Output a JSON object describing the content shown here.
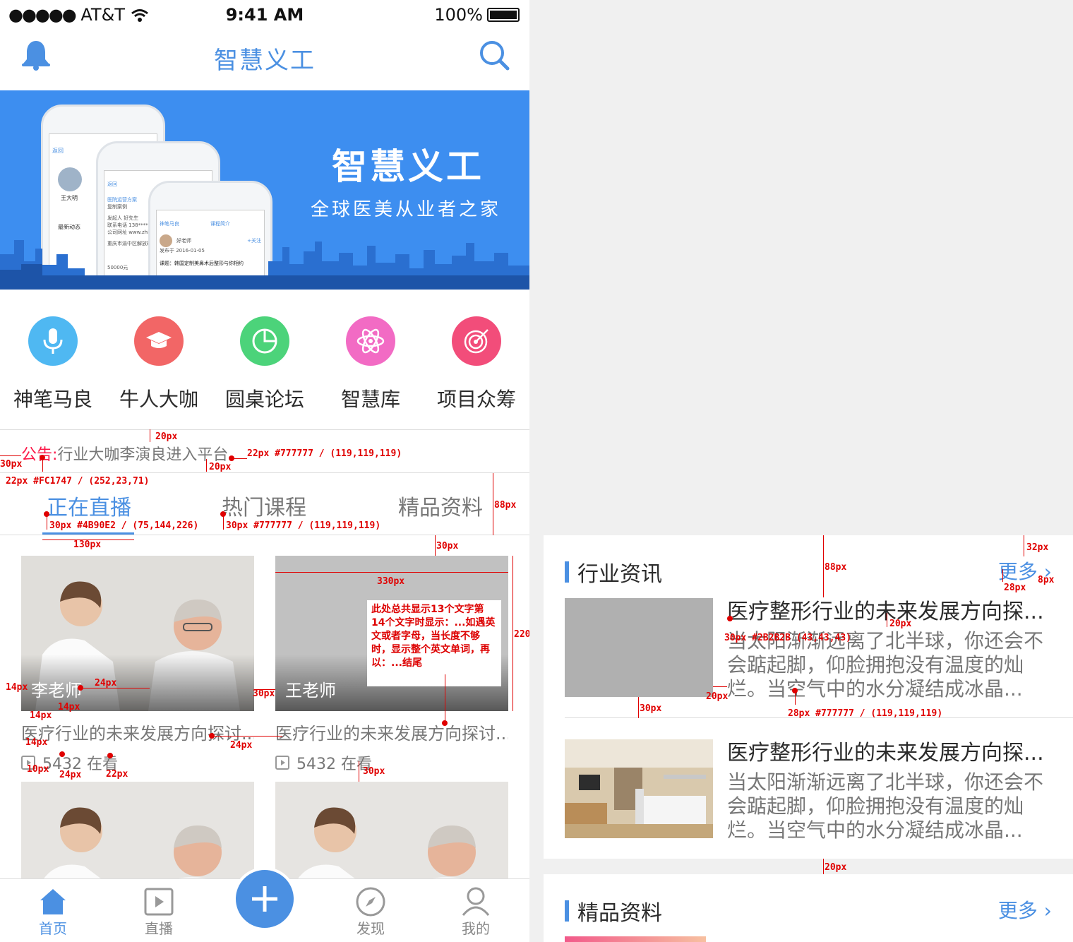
{
  "status": {
    "carrier": "AT&T",
    "time": "9:41 AM",
    "battery": "100%"
  },
  "nav": {
    "title": "智慧义工"
  },
  "banner": {
    "title": "智慧义工",
    "subtitle": "全球医美从业者之家",
    "mock1": {
      "back": "返回",
      "name": "王大明",
      "tag": "最新动态"
    },
    "mock2": {
      "back": "返回",
      "title": "医院运营方案",
      "sub": "复制案例",
      "r1": "发起人",
      "r1v": "好先生",
      "r2": "联系电话",
      "r2v": "138*****",
      "r3": "公司网址",
      "r3v": "www.zhi",
      "loc": "重庆市渝中区解放碑",
      "price": "50000元"
    },
    "mock3": {
      "back": "神笔马良",
      "title": "课程简介",
      "teacher": "好老师",
      "date": "发布于 2016-01-05",
      "follow": "+关注",
      "course": "课题：韩国定制美鼻术后整形与你相约"
    }
  },
  "categories": [
    {
      "label": "神笔马良",
      "color": "#4fb8f2"
    },
    {
      "label": "牛人大咖",
      "color": "#f26666"
    },
    {
      "label": "圆桌论坛",
      "color": "#4cd37a"
    },
    {
      "label": "智慧库",
      "color": "#f26bc4"
    },
    {
      "label": "项目众筹",
      "color": "#f24d7a"
    }
  ],
  "notice": {
    "head": "公告:",
    "text": "行业大咖李演良进入平台"
  },
  "tabs": [
    {
      "label": "正在直播"
    },
    {
      "label": "热门课程"
    },
    {
      "label": "精品资料"
    }
  ],
  "cards": [
    {
      "teacher": "李老师",
      "title": "医疗行业的未来发展方向探讨...",
      "watch": "5432 在看"
    },
    {
      "teacher": "王老师",
      "title": "医疗行业的未来发展方向探讨...",
      "watch": "5432 在看"
    }
  ],
  "note": {
    "text": "此处总共显示13个文字第14个文字时显示：...如遇英文或者字母，当长度不够时，显示整个英文单词，再以：...结尾"
  },
  "annotations": {
    "a1": "20px",
    "a2": "30px",
    "a3": "22px #777777 / (119,119,119)",
    "a4": "20px",
    "a5": "22px #FC1747 / (252,23,71)",
    "a6": "88px",
    "a7": "30px #4B90E2 / (75,144,226)",
    "a8": "30px #777777 / (119,119,119)",
    "a9": "130px",
    "a10": "30px",
    "a11": "330px",
    "a12": "220px",
    "a13": "14px",
    "a14": "24px",
    "a15": "14px",
    "a16": "14px",
    "a17": "30px",
    "a18": "14px",
    "a19": "24px",
    "a20": "10px",
    "a21": "24px",
    "a22": "22px",
    "a23": "30px",
    "r1": "88px",
    "r2": "32px",
    "r3": "28px",
    "r4": "8px",
    "r5": "20px",
    "r6": "30px #2B2B2B (43,43,43)",
    "r7": "20px",
    "r8": "30px",
    "r9": "28px #777777 / (119,119,119)",
    "r10": "20px"
  },
  "tabbar": [
    {
      "label": "首页"
    },
    {
      "label": "直播"
    },
    {
      "label": "发现"
    },
    {
      "label": "我的"
    }
  ],
  "right": {
    "section1": {
      "title": "行业资讯",
      "more": "更多"
    },
    "news": [
      {
        "title": "医疗整形行业的未来发展方向探...",
        "desc": "当太阳渐渐远离了北半球，你还会不会踮起脚，仰脸拥抱没有温度的灿烂。当空气中的水分凝结成冰晶..."
      },
      {
        "title": "医疗整形行业的未来发展方向探...",
        "desc": "当太阳渐渐远离了北半球，你还会不会踮起脚，仰脸拥抱没有温度的灿烂。当空气中的水分凝结成冰晶..."
      }
    ],
    "section2": {
      "title": "精品资料",
      "more": "更多"
    }
  }
}
